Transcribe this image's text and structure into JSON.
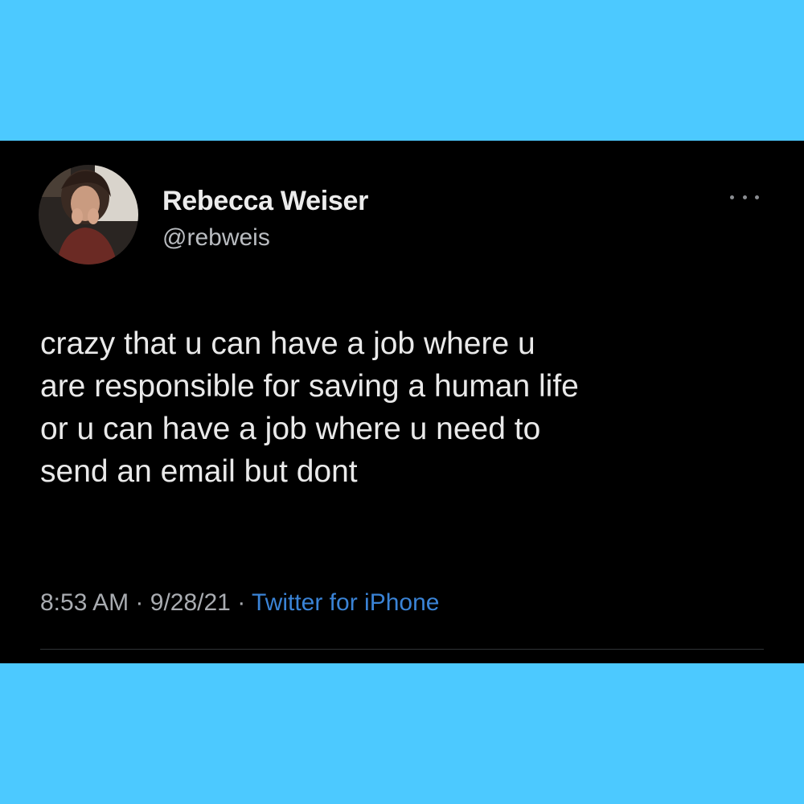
{
  "colors": {
    "frame": "#4cc9ff",
    "card_background": "#000000",
    "text_primary": "#e9e9e9",
    "text_secondary": "#a9acb1",
    "link": "#3a83d6"
  },
  "tweet": {
    "author": {
      "display_name": "Rebecca Weiser",
      "handle": "@rebweis",
      "avatar_icon": "profile-photo"
    },
    "more_icon": "more-horizontal-icon",
    "text": "crazy that u can have a job where u\nare responsible for saving a human life\nor u can have a job where u need to\nsend an email but dont",
    "time": "8:53 AM",
    "separator": "·",
    "date": "9/28/21",
    "source": "Twitter for iPhone"
  }
}
